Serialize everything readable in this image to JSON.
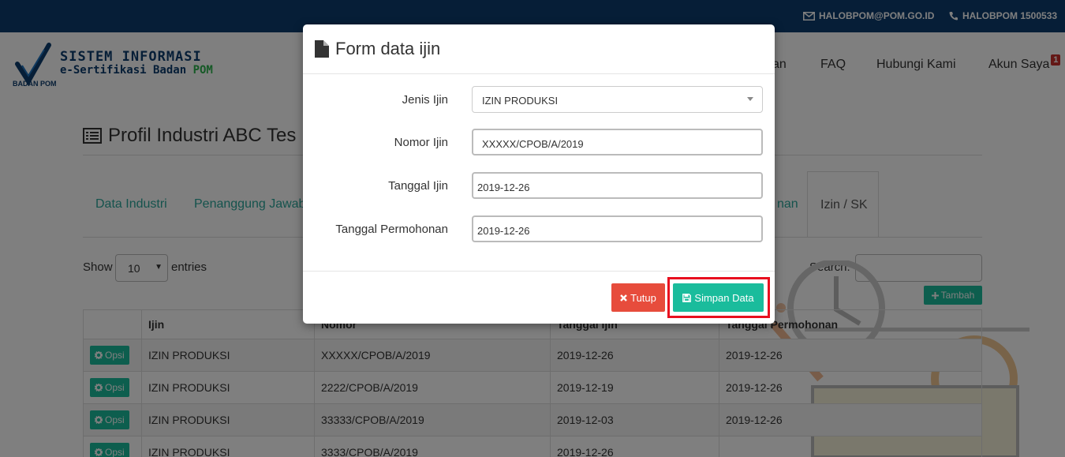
{
  "topbar": {
    "email": "HALOBPOM@POM.GO.ID",
    "phone": "HALOBPOM 1500533",
    "email_icon": "envelope-icon",
    "phone_icon": "phone-icon"
  },
  "header": {
    "logo_label": "BADAN POM",
    "brand_title": "SISTEM INFORMASI",
    "brand_sub_prefix": "e-Sertifikasi Badan ",
    "brand_sub_accent": "POM",
    "nav_partial": "an",
    "nav": {
      "faq": "FAQ",
      "hubungi": "Hubungi Kami",
      "akun": "Akun Saya",
      "akun_badge": "1"
    }
  },
  "page": {
    "title": "Profil Industri ABC Tes",
    "tabs": {
      "data_industri": "Data Industri",
      "penanggung": "Penanggung Jawab",
      "partial": "nan",
      "izin": "Izin / SK"
    },
    "show_label": "Show",
    "entries_value": "10",
    "entries_label": "entries",
    "search_label": "Search:",
    "tambah_label": "Tambah"
  },
  "table": {
    "headers": {
      "opsi": "",
      "ijin": "Ijin",
      "nomor": "Nomor",
      "tanggal_ijin": "Tanggal Ijin",
      "tanggal_permohonan": "Tanggal Permohonan"
    },
    "opsi_label": "Opsi",
    "rows": [
      {
        "ijin": "IZIN PRODUKSI",
        "nomor": "XXXXX/CPOB/A/2019",
        "tanggal_ijin": "2019-12-26",
        "tanggal_permohonan": "2019-12-26"
      },
      {
        "ijin": "IZIN PRODUKSI",
        "nomor": "2222/CPOB/A/2019",
        "tanggal_ijin": "2019-12-19",
        "tanggal_permohonan": "2019-12-26"
      },
      {
        "ijin": "IZIN PRODUKSI",
        "nomor": "33333/CPOB/A/2019",
        "tanggal_ijin": "2019-12-03",
        "tanggal_permohonan": "2019-12-26"
      },
      {
        "ijin": "IZIN PRODUKSI",
        "nomor": "3333/CPOB/A/2019",
        "tanggal_ijin": "2019-12-26",
        "tanggal_permohonan": ""
      }
    ]
  },
  "modal": {
    "title": "Form data ijin",
    "labels": {
      "jenis": "Jenis Ijin",
      "nomor": "Nomor Ijin",
      "tanggal": "Tanggal Ijin",
      "permohonan": "Tanggal Permohonan"
    },
    "values": {
      "jenis": "IZIN PRODUKSI",
      "nomor": "XXXXX/CPOB/A/2019",
      "tanggal": "2019-12-26",
      "permohonan": "2019-12-26"
    },
    "buttons": {
      "tutup": "Tutup",
      "simpan": "Simpan Data"
    }
  },
  "colors": {
    "topbar": "#0d3d6e",
    "accent": "#1abc9c",
    "danger": "#e74c3c",
    "highlight": "#e8101f"
  }
}
